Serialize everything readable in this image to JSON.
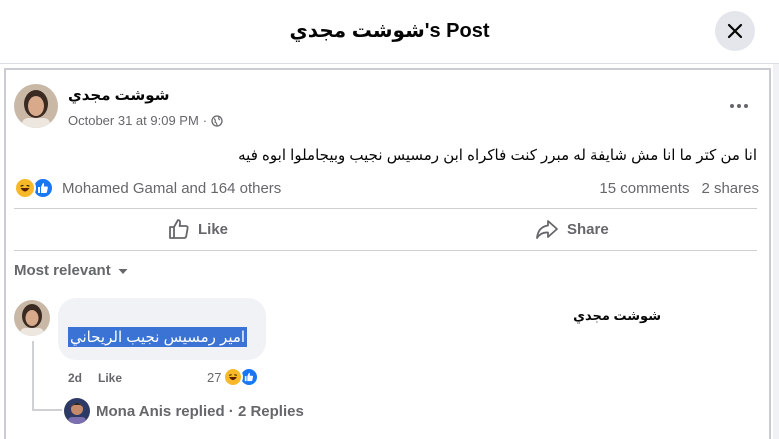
{
  "header": {
    "title": "شوشت مجدي's Post",
    "close_icon": "close-icon"
  },
  "post": {
    "author": "شوشت مجدي",
    "timestamp": "October 31 at 9:09 PM",
    "separator": "·",
    "audience_icon": "globe-icon",
    "more_icon": "more-horizontal-icon",
    "text": "انا من كتر ما انا مش شايفة له مبرر كنت فاكراه ابن رمسيس نجيب وبيجاملوا ابوه فيه",
    "reactions": {
      "icons": [
        "haha-icon",
        "like-icon"
      ],
      "summary": "Mohamed Gamal and 164 others"
    },
    "comments_count": "15 comments",
    "shares_count": "2 shares",
    "actions": {
      "like": "Like",
      "share": "Share"
    }
  },
  "comments_section": {
    "sort_label": "Most relevant",
    "comment": {
      "author": "شوشت مجدي",
      "text": "امير رمسيس نجيب الريحاني",
      "age": "2d",
      "like_label": "Like",
      "reaction_count": "27",
      "reaction_icons": [
        "haha-icon",
        "like-icon"
      ]
    },
    "replies": {
      "text": "Mona Anis replied · 2 Replies"
    }
  },
  "colors": {
    "like_blue": "#1877f2",
    "haha_yellow": "#f7b928",
    "secondary_text": "#65676b",
    "selection_blue": "#3b73d4"
  }
}
